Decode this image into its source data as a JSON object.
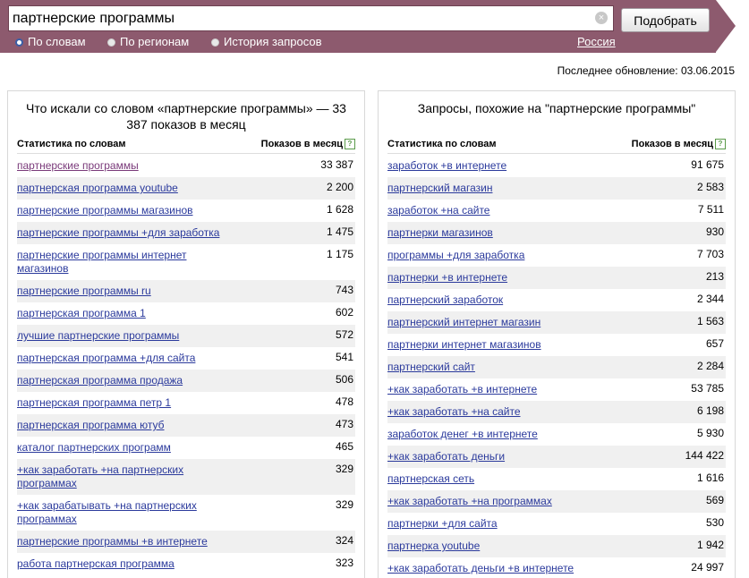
{
  "search": {
    "query": "партнерские программы",
    "submit_label": "Подобрать"
  },
  "modes": [
    {
      "label": "По словам",
      "selected": true
    },
    {
      "label": "По регионам",
      "selected": false
    },
    {
      "label": "История запросов",
      "selected": false
    }
  ],
  "region_label": "Россия",
  "last_update": "Последнее обновление: 03.06.2015",
  "left_panel": {
    "title": "Что искали со словом «партнерские программы» — 33 387 показов в месяц",
    "col_words": "Статистика по словам",
    "col_count": "Показов в месяц",
    "rows": [
      {
        "phrase": "партнерские программы",
        "count": "33 387"
      },
      {
        "phrase": "партнерская программа youtube",
        "count": "2 200"
      },
      {
        "phrase": "партнерские программы магазинов",
        "count": "1 628"
      },
      {
        "phrase": "партнерские программы +для заработка",
        "count": "1 475"
      },
      {
        "phrase": "партнерские программы интернет магазинов",
        "count": "1 175"
      },
      {
        "phrase": "партнерские программы ru",
        "count": "743"
      },
      {
        "phrase": "партнерская программа 1",
        "count": "602"
      },
      {
        "phrase": "лучшие партнерские программы",
        "count": "572"
      },
      {
        "phrase": "партнерская программа +для сайта",
        "count": "541"
      },
      {
        "phrase": "партнерская программа продажа",
        "count": "506"
      },
      {
        "phrase": "партнерская программа петр 1",
        "count": "478"
      },
      {
        "phrase": "партнерская программа ютуб",
        "count": "473"
      },
      {
        "phrase": "каталог партнерских программ",
        "count": "465"
      },
      {
        "phrase": "+как заработать +на партнерских программах",
        "count": "329"
      },
      {
        "phrase": "+как зарабатывать +на партнерских программах",
        "count": "329"
      },
      {
        "phrase": "партнерские программы +в интернете",
        "count": "324"
      },
      {
        "phrase": "работа партнерская программа",
        "count": "323"
      }
    ]
  },
  "right_panel": {
    "title": "Запросы, похожие на \"партнерские программы\"",
    "col_words": "Статистика по словам",
    "col_count": "Показов в месяц",
    "rows": [
      {
        "phrase": "заработок +в интернете",
        "count": "91 675"
      },
      {
        "phrase": "партнерский магазин",
        "count": "2 583"
      },
      {
        "phrase": "заработок +на сайте",
        "count": "7 511"
      },
      {
        "phrase": "партнерки магазинов",
        "count": "930"
      },
      {
        "phrase": "программы +для заработка",
        "count": "7 703"
      },
      {
        "phrase": "партнерки +в интернете",
        "count": "213"
      },
      {
        "phrase": "партнерский заработок",
        "count": "2 344"
      },
      {
        "phrase": "партнерский интернет магазин",
        "count": "1 563"
      },
      {
        "phrase": "партнерки интернет магазинов",
        "count": "657"
      },
      {
        "phrase": "партнерский сайт",
        "count": "2 284"
      },
      {
        "phrase": "+как заработать +в интернете",
        "count": "53 785"
      },
      {
        "phrase": "+как заработать +на сайте",
        "count": "6 198"
      },
      {
        "phrase": "заработок денег +в интернете",
        "count": "5 930"
      },
      {
        "phrase": "+как заработать деньги",
        "count": "144 422"
      },
      {
        "phrase": "партнерская сеть",
        "count": "1 616"
      },
      {
        "phrase": "+как заработать +на программах",
        "count": "569"
      },
      {
        "phrase": "партнерки +для сайта",
        "count": "530"
      },
      {
        "phrase": "партнерка youtube",
        "count": "1 942"
      },
      {
        "phrase": "+как заработать деньги +в интернете",
        "count": "24 997"
      }
    ]
  }
}
